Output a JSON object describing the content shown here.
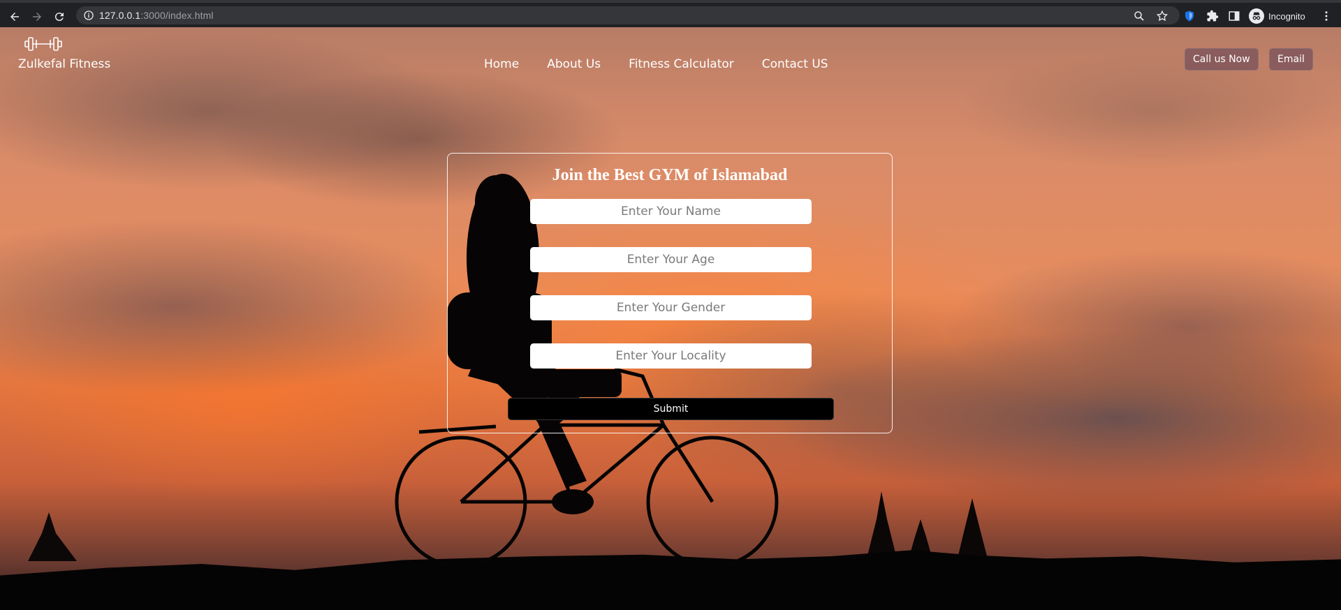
{
  "browser": {
    "url_host": "127.0.0.1",
    "url_rest": ":3000/index.html",
    "profile_label": "Incognito"
  },
  "site": {
    "brand": "Zulkefal Fitness",
    "nav": [
      "Home",
      "About Us",
      "Fitness Calculator",
      "Contact US"
    ],
    "call_button": "Call us Now",
    "email_button": "Email"
  },
  "form": {
    "title": "Join the Best GYM of Islamabad",
    "name_placeholder": "Enter Your Name",
    "age_placeholder": "Enter Your Age",
    "gender_placeholder": "Enter Your Gender",
    "locality_placeholder": "Enter Your Locality",
    "submit_label": "Submit"
  }
}
